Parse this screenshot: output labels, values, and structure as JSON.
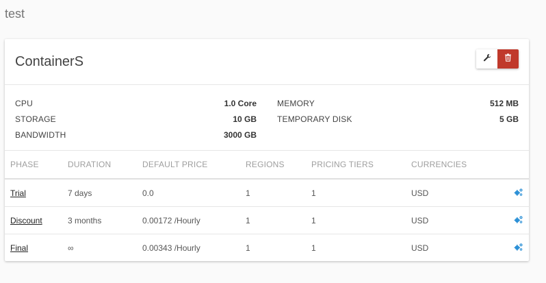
{
  "page": {
    "title": "test"
  },
  "card": {
    "title": "ContainerS",
    "actions": {
      "edit_icon": "wrench-icon",
      "delete_icon": "trash-icon",
      "delete_color": "#c0392b"
    }
  },
  "specs": {
    "cpu": {
      "label": "CPU",
      "value": "1.0 Core"
    },
    "storage": {
      "label": "STORAGE",
      "value": "10 GB"
    },
    "bandwidth": {
      "label": "BANDWIDTH",
      "value": "3000 GB"
    },
    "memory": {
      "label": "MEMORY",
      "value": "512 MB"
    },
    "temp_disk": {
      "label": "TEMPORARY DISK",
      "value": "5 GB"
    }
  },
  "table": {
    "headers": [
      "PHASE",
      "DURATION",
      "DEFAULT PRICE",
      "REGIONS",
      "PRICING TIERS",
      "CURRENCIES"
    ],
    "rows": [
      {
        "phase": "Trial",
        "duration": "7 days",
        "price": "0.0",
        "regions": "1",
        "tiers": "1",
        "currency": "USD"
      },
      {
        "phase": "Discount",
        "duration": "3 months",
        "price": "0.00172 /Hourly",
        "regions": "1",
        "tiers": "1",
        "currency": "USD"
      },
      {
        "phase": "Final",
        "duration": "∞",
        "price": "0.00343 /Hourly",
        "regions": "1",
        "tiers": "1",
        "currency": "USD"
      }
    ],
    "row_action_icon": "cogs-icon",
    "accent_color": "#2a8fd6"
  }
}
